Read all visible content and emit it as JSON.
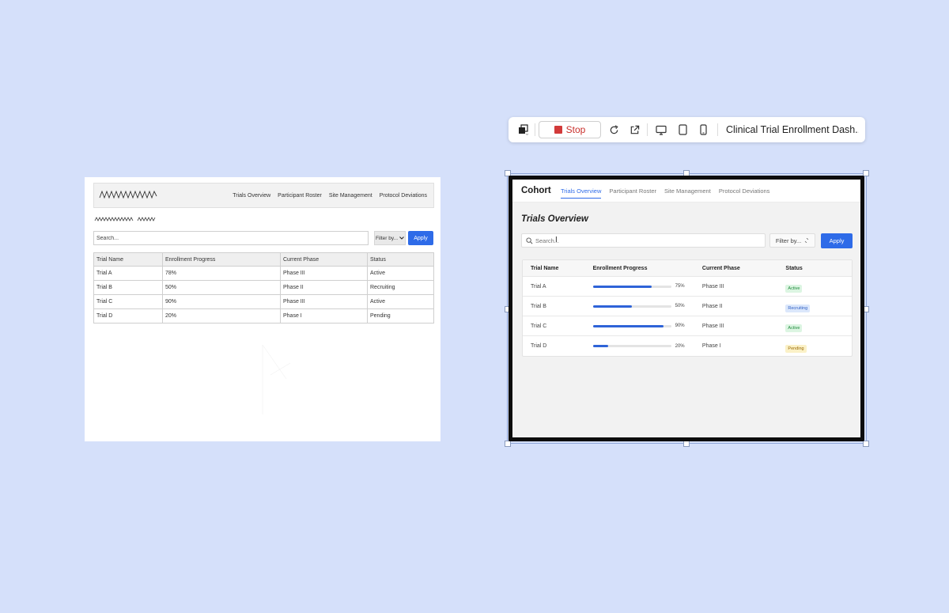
{
  "sketch": {
    "nav_links": [
      "Trials Overview",
      "Participant Roster",
      "Site Management",
      "Protocol Deviations"
    ],
    "search_value": "Search...",
    "filter_label": "Filter by...",
    "apply_label": "Apply",
    "columns": [
      "Trial Name",
      "Enrollment Progress",
      "Current Phase",
      "Status"
    ],
    "rows": [
      [
        "Trial A",
        "78%",
        "Phase III",
        "Active"
      ],
      [
        "Trial B",
        "50%",
        "Phase II",
        "Recruiting"
      ],
      [
        "Trial C",
        "90%",
        "Phase III",
        "Active"
      ],
      [
        "Trial D",
        "20%",
        "Phase I",
        "Pending"
      ]
    ]
  },
  "toolbar": {
    "stop_label": "Stop",
    "title": "Clinical Trial Enrollment Dash...",
    "icons": [
      "layers-icon",
      "stop-icon",
      "refresh-icon",
      "external-link-icon",
      "desktop-icon",
      "tablet-icon",
      "mobile-icon"
    ]
  },
  "app": {
    "brand": "Cohort",
    "tabs": [
      {
        "label": "Trials Overview",
        "active": true
      },
      {
        "label": "Participant Roster",
        "active": false
      },
      {
        "label": "Site Management",
        "active": false
      },
      {
        "label": "Protocol Deviations",
        "active": false
      }
    ],
    "page_title": "Trials Overview",
    "search_placeholder": "Search...",
    "filter_label": "Filter by...",
    "apply_label": "Apply",
    "columns": [
      "Trial Name",
      "Enrollment Progress",
      "Current Phase",
      "Status"
    ],
    "rows": [
      {
        "name": "Trial A",
        "progress": 75,
        "progress_label": "75%",
        "phase": "Phase III",
        "status": "Active",
        "status_kind": "active"
      },
      {
        "name": "Trial B",
        "progress": 50,
        "progress_label": "50%",
        "phase": "Phase II",
        "status": "Recruiting",
        "status_kind": "recruiting"
      },
      {
        "name": "Trial C",
        "progress": 90,
        "progress_label": "90%",
        "phase": "Phase III",
        "status": "Active",
        "status_kind": "active"
      },
      {
        "name": "Trial D",
        "progress": 20,
        "progress_label": "20%",
        "phase": "Phase I",
        "status": "Pending",
        "status_kind": "pending"
      }
    ],
    "colors": {
      "accent": "#2e6be8",
      "active_badge": "#dcf5e2",
      "recruiting_badge": "#dbe7fb",
      "pending_badge": "#fbf1c7"
    }
  }
}
